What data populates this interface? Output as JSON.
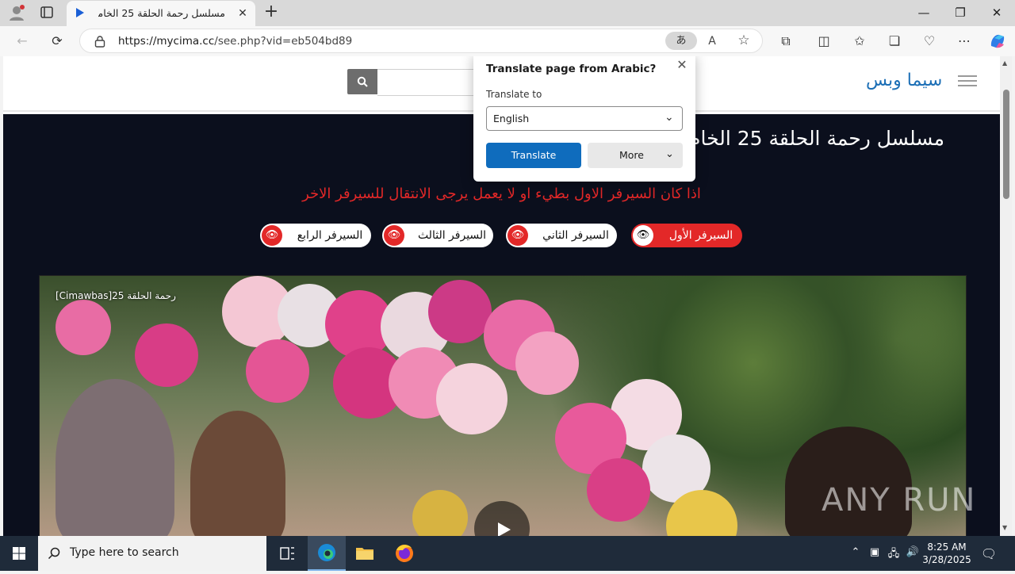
{
  "browser": {
    "tab_title": "مسلسل رحمة الحلقة 25 الخامسة وا",
    "url_scheme_host": "https://mycima.cc",
    "url_path": "/see.php?vid=eb504bd89",
    "translate_pill_glyph": "あ"
  },
  "site": {
    "logo": "سيما وبس",
    "search_placeholder": "",
    "page_title": "مسلسل رحمة الحلقة 25 الخام",
    "notice": "اذا كان السيرفر الاول بطيء او لا يعمل يرجى الانتقال للسيرفر الاخر",
    "servers": [
      {
        "label": "السيرفر الأول",
        "active": true
      },
      {
        "label": "السيرفر الثاني",
        "active": false
      },
      {
        "label": "السيرفر الثالث",
        "active": false
      },
      {
        "label": "السيرفر الرابع",
        "active": false
      }
    ],
    "video_title": "[Cimawbas]25 رحمة الحلقة"
  },
  "translate_popup": {
    "title": "Translate page from Arabic?",
    "label": "Translate to",
    "selected_language": "English",
    "translate_button": "Translate",
    "more_button": "More"
  },
  "watermark": "ANY RUN",
  "taskbar": {
    "search_placeholder": "Type here to search",
    "time": "8:25 AM",
    "date": "3/28/2025"
  },
  "colors": {
    "accent": "#0f6cbd",
    "server_red": "#e32828",
    "page_dark": "#0b0f1d",
    "logo_blue": "#1c6fb6"
  }
}
